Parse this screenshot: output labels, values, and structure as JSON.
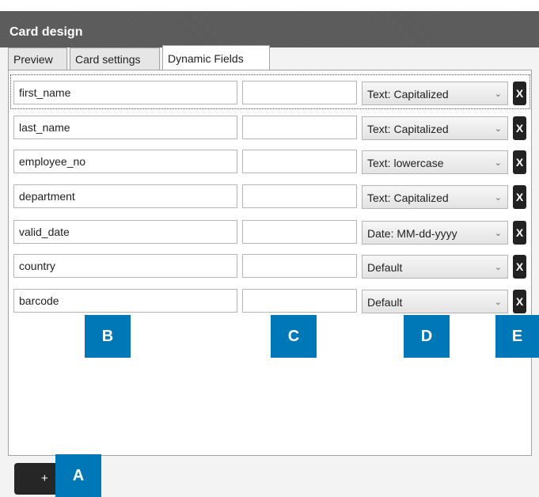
{
  "window": {
    "title": "Card design"
  },
  "tabs": [
    {
      "label": "Preview"
    },
    {
      "label": "Card settings"
    },
    {
      "label": "Dynamic Fields"
    }
  ],
  "active_tab": "Dynamic Fields",
  "rows": [
    {
      "name": "first_name",
      "alias": "",
      "format": "Text: Capitalized",
      "remove_label": "X"
    },
    {
      "name": "last_name",
      "alias": "",
      "format": "Text: Capitalized",
      "remove_label": "X"
    },
    {
      "name": "employee_no",
      "alias": "",
      "format": "Text: lowercase",
      "remove_label": "X"
    },
    {
      "name": "department",
      "alias": "",
      "format": "Text: Capitalized",
      "remove_label": "X"
    },
    {
      "name": "valid_date",
      "alias": "",
      "format": "Date: MM-dd-yyyy",
      "remove_label": "X"
    },
    {
      "name": "country",
      "alias": "",
      "format": "Default",
      "remove_label": "X"
    },
    {
      "name": "barcode",
      "alias": "",
      "format": "Default",
      "remove_label": "X"
    }
  ],
  "callouts": {
    "a": "A",
    "b": "B",
    "c": "C",
    "d": "D",
    "e": "E"
  },
  "add_button": {
    "label": "+"
  },
  "colors": {
    "titlebar": "#5a5a5a",
    "callout": "#0077b6",
    "button": "#262626"
  },
  "icons": {
    "dropdown": "chevron-down-icon"
  }
}
